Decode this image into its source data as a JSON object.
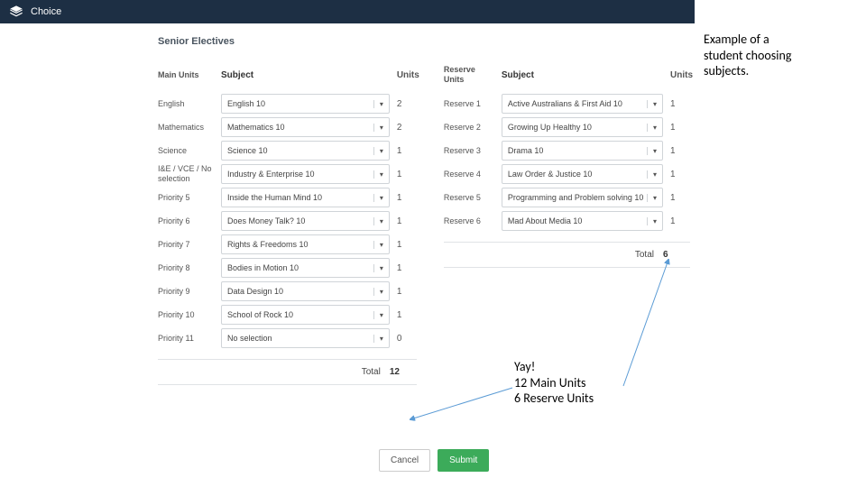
{
  "topbar": {
    "title": "Choice"
  },
  "section_title": "Senior Electives",
  "headers": {
    "main": "Main Units",
    "subject": "Subject",
    "units": "Units",
    "reserve": "Reserve Units"
  },
  "main_rows": [
    {
      "label": "English",
      "value": "English 10",
      "units": "2"
    },
    {
      "label": "Mathematics",
      "value": "Mathematics 10",
      "units": "2"
    },
    {
      "label": "Science",
      "value": "Science 10",
      "units": "1"
    },
    {
      "label": "I&E / VCE / No selection",
      "value": "Industry & Enterprise 10",
      "units": "1"
    },
    {
      "label": "Priority 5",
      "value": "Inside the Human Mind 10",
      "units": "1"
    },
    {
      "label": "Priority 6",
      "value": "Does Money Talk? 10",
      "units": "1"
    },
    {
      "label": "Priority 7",
      "value": "Rights & Freedoms 10",
      "units": "1"
    },
    {
      "label": "Priority 8",
      "value": "Bodies in Motion 10",
      "units": "1"
    },
    {
      "label": "Priority 9",
      "value": "Data Design 10",
      "units": "1"
    },
    {
      "label": "Priority 10",
      "value": "School of Rock 10",
      "units": "1"
    },
    {
      "label": "Priority 11",
      "value": "No selection",
      "units": "0"
    }
  ],
  "reserve_rows": [
    {
      "label": "Reserve 1",
      "value": "Active Australians & First Aid 10",
      "units": "1"
    },
    {
      "label": "Reserve 2",
      "value": "Growing Up Healthy 10",
      "units": "1"
    },
    {
      "label": "Reserve 3",
      "value": "Drama 10",
      "units": "1"
    },
    {
      "label": "Reserve 4",
      "value": "Law Order & Justice 10",
      "units": "1"
    },
    {
      "label": "Reserve 5",
      "value": "Programming and Problem solving 10",
      "units": "1"
    },
    {
      "label": "Reserve 6",
      "value": "Mad About Media 10",
      "units": "1"
    }
  ],
  "totals": {
    "label": "Total",
    "main": "12",
    "reserve": "6"
  },
  "buttons": {
    "cancel": "Cancel",
    "submit": "Submit"
  },
  "annotations": {
    "a1_l1": "Example of a",
    "a1_l2": "student choosing",
    "a1_l3": "subjects.",
    "a2_l1": "Yay!",
    "a2_l2": "12 Main Units",
    "a2_l3": "6 Reserve Units"
  }
}
